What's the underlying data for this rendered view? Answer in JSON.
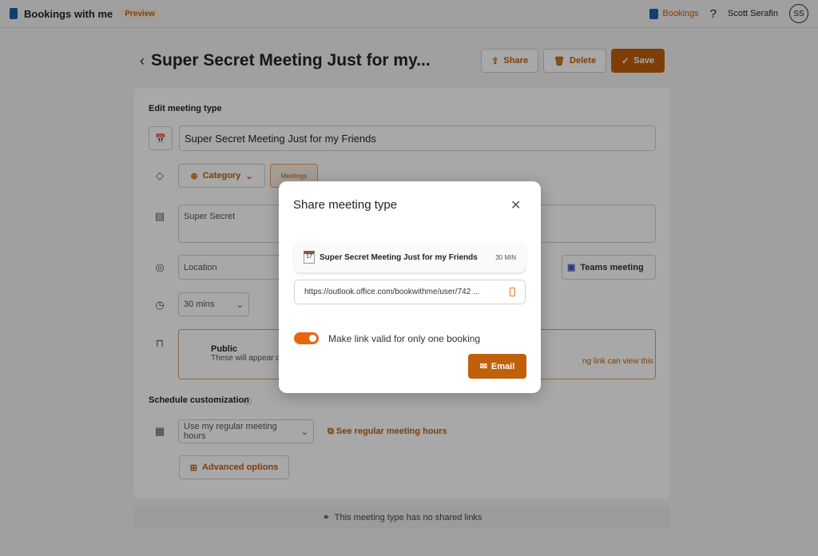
{
  "topbar": {
    "app_name": "Bookings with me",
    "preview": "Preview",
    "bookings_link": "Bookings",
    "help": "?",
    "user_name": "Scott Serafin",
    "avatar_initials": "SS"
  },
  "header": {
    "back": "‹",
    "title": "Super Secret Meeting Just for my...",
    "share": "Share",
    "delete": "Delete",
    "save": "Save"
  },
  "form": {
    "section_title": "Edit meeting type",
    "name_value": "Super Secret Meeting Just for my Friends",
    "category": "Category",
    "category_tag": "Meetings",
    "description": "Super Secret",
    "location_placeholder": "Location",
    "teams": "Teams meeting",
    "duration": "30 mins",
    "visibility_title": "Public",
    "visibility_desc": "These will appear o",
    "visibility_desc_right": "ng link can view this",
    "schedule_title": "Schedule customization",
    "hours_select": "Use my regular meeting hours",
    "see_hours": "See regular meeting hours",
    "advanced": "Advanced options"
  },
  "footer": {
    "text": "This meeting type has no shared links"
  },
  "modal": {
    "title": "Share meeting type",
    "meeting_name": "Super Secret Meeting Just for my Friends",
    "calendar_day": "17",
    "duration": "30 MIN",
    "url": "https://outlook.office.com/bookwithme/user/742 ...",
    "toggle_label": "Make link valid for only one booking",
    "toggle_on": true,
    "email": "Email"
  },
  "colors": {
    "accent": "#c0600a",
    "toggle": "#e8650f"
  }
}
